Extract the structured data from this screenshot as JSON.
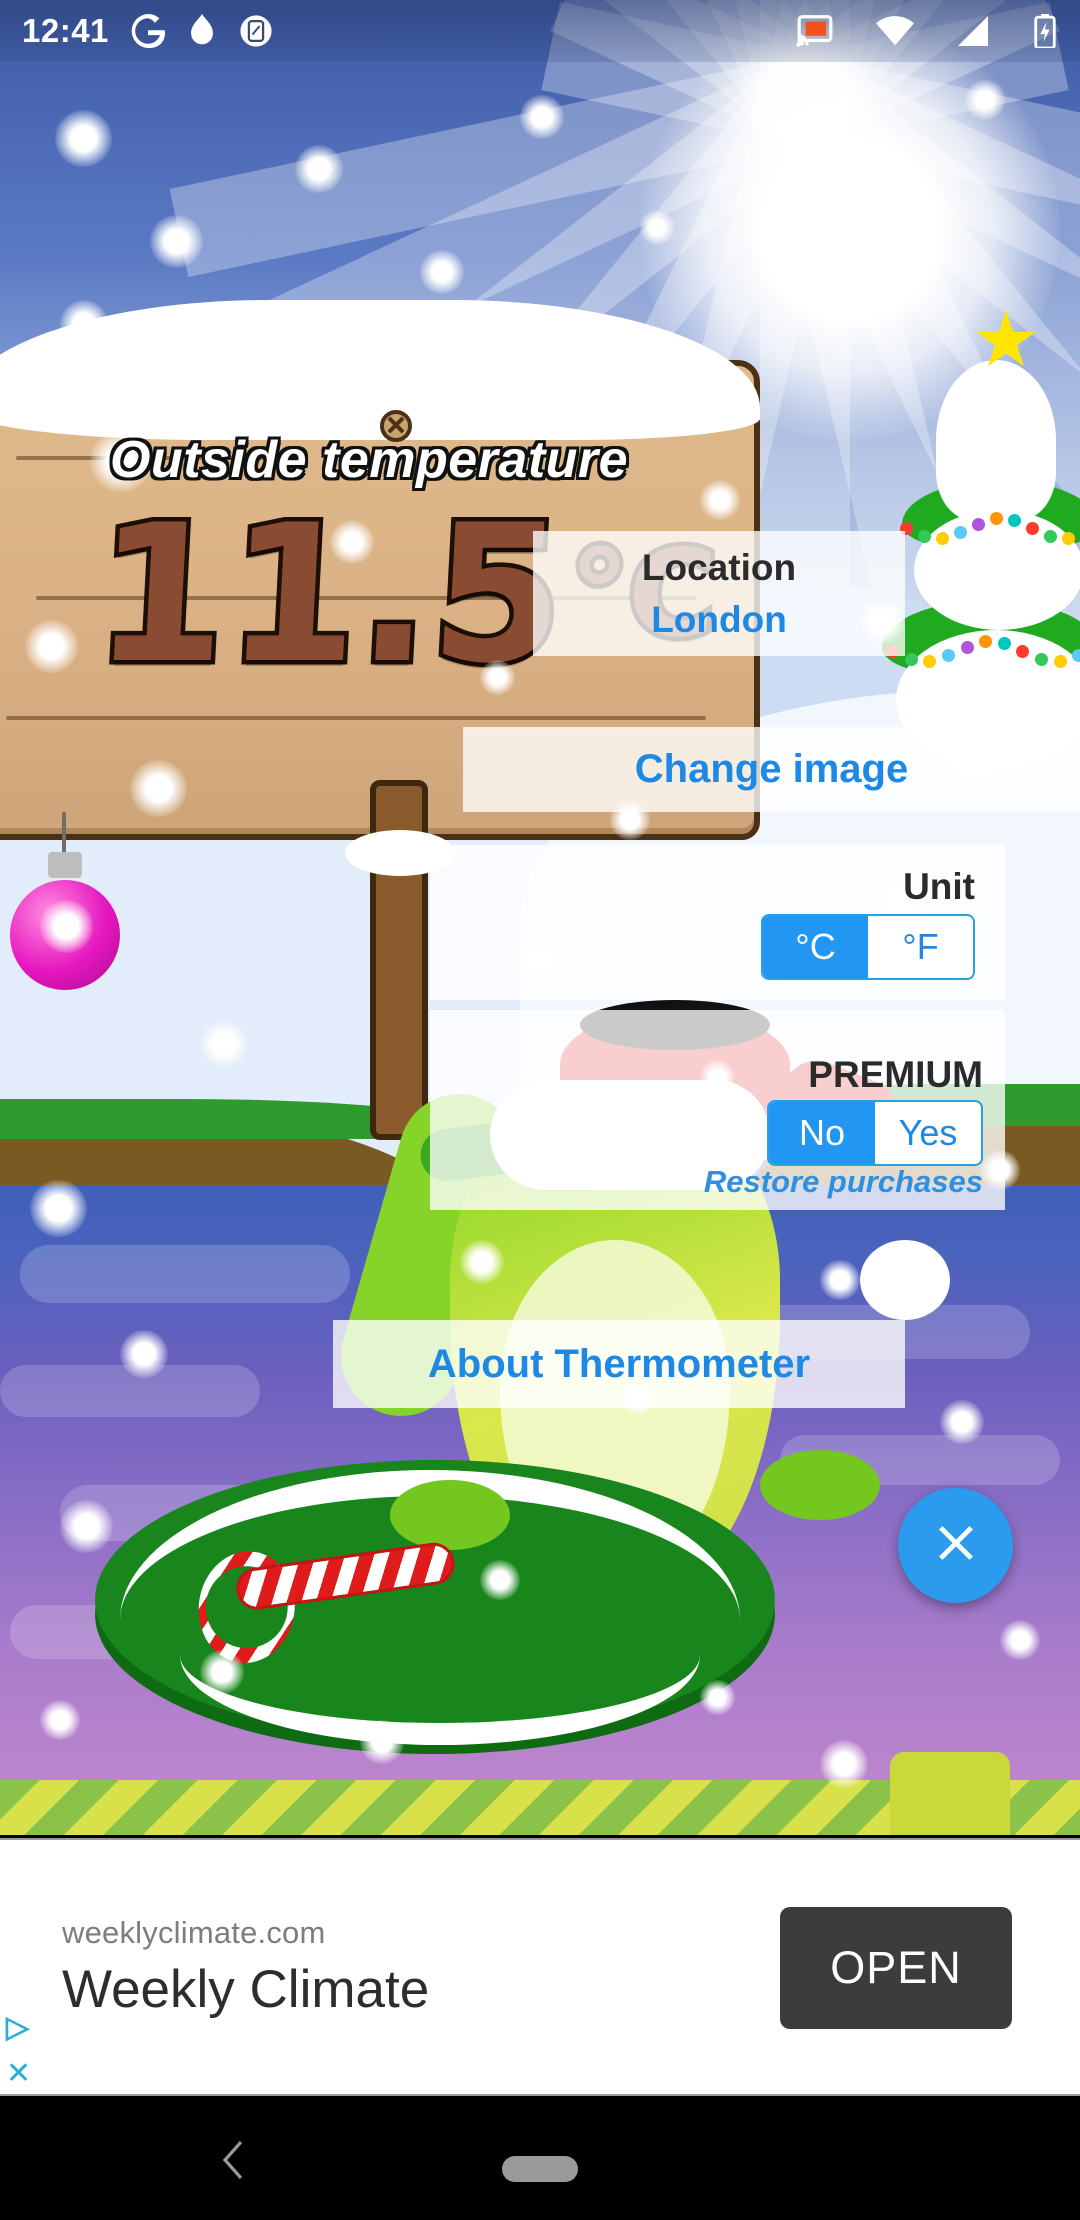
{
  "status_bar": {
    "time": "12:41",
    "left_icons": [
      "google-icon",
      "flame-icon",
      "screenshot-icon"
    ],
    "right_icons": [
      "cast-icon",
      "wifi-icon",
      "signal-icon",
      "battery-charging-icon"
    ]
  },
  "app": {
    "caption": "Outside temperature",
    "temperature_value": "11.5",
    "temperature_unit_glyph": "°C",
    "temperature_display": "11.5°C"
  },
  "settings": {
    "location_label": "Location",
    "location_value": "London",
    "change_image_label": "Change image",
    "unit_label": "Unit",
    "unit_options": [
      "°C",
      "°F"
    ],
    "unit_selected": "°C",
    "premium_label": "PREMIUM",
    "premium_options": [
      "No",
      "Yes"
    ],
    "premium_selected": "No",
    "restore_label": "Restore purchases",
    "about_label": "About Thermometer",
    "share_icon": "share-icon",
    "close_icon": "close-icon"
  },
  "ad": {
    "domain": "weeklyclimate.com",
    "title": "Weekly Climate",
    "cta_label": "OPEN",
    "info_flag": "▷",
    "close_flag": "✕"
  },
  "navigation": {
    "back_icon": "back-chevron-icon",
    "home_pill": "home-pill-icon"
  },
  "colors": {
    "accent_blue": "#2196f3",
    "link_blue": "#1e88e5",
    "fab_blue": "#2b9ced",
    "ad_button": "#3c3c3c",
    "panel_bg": "rgba(255,255,255,0.78)"
  }
}
